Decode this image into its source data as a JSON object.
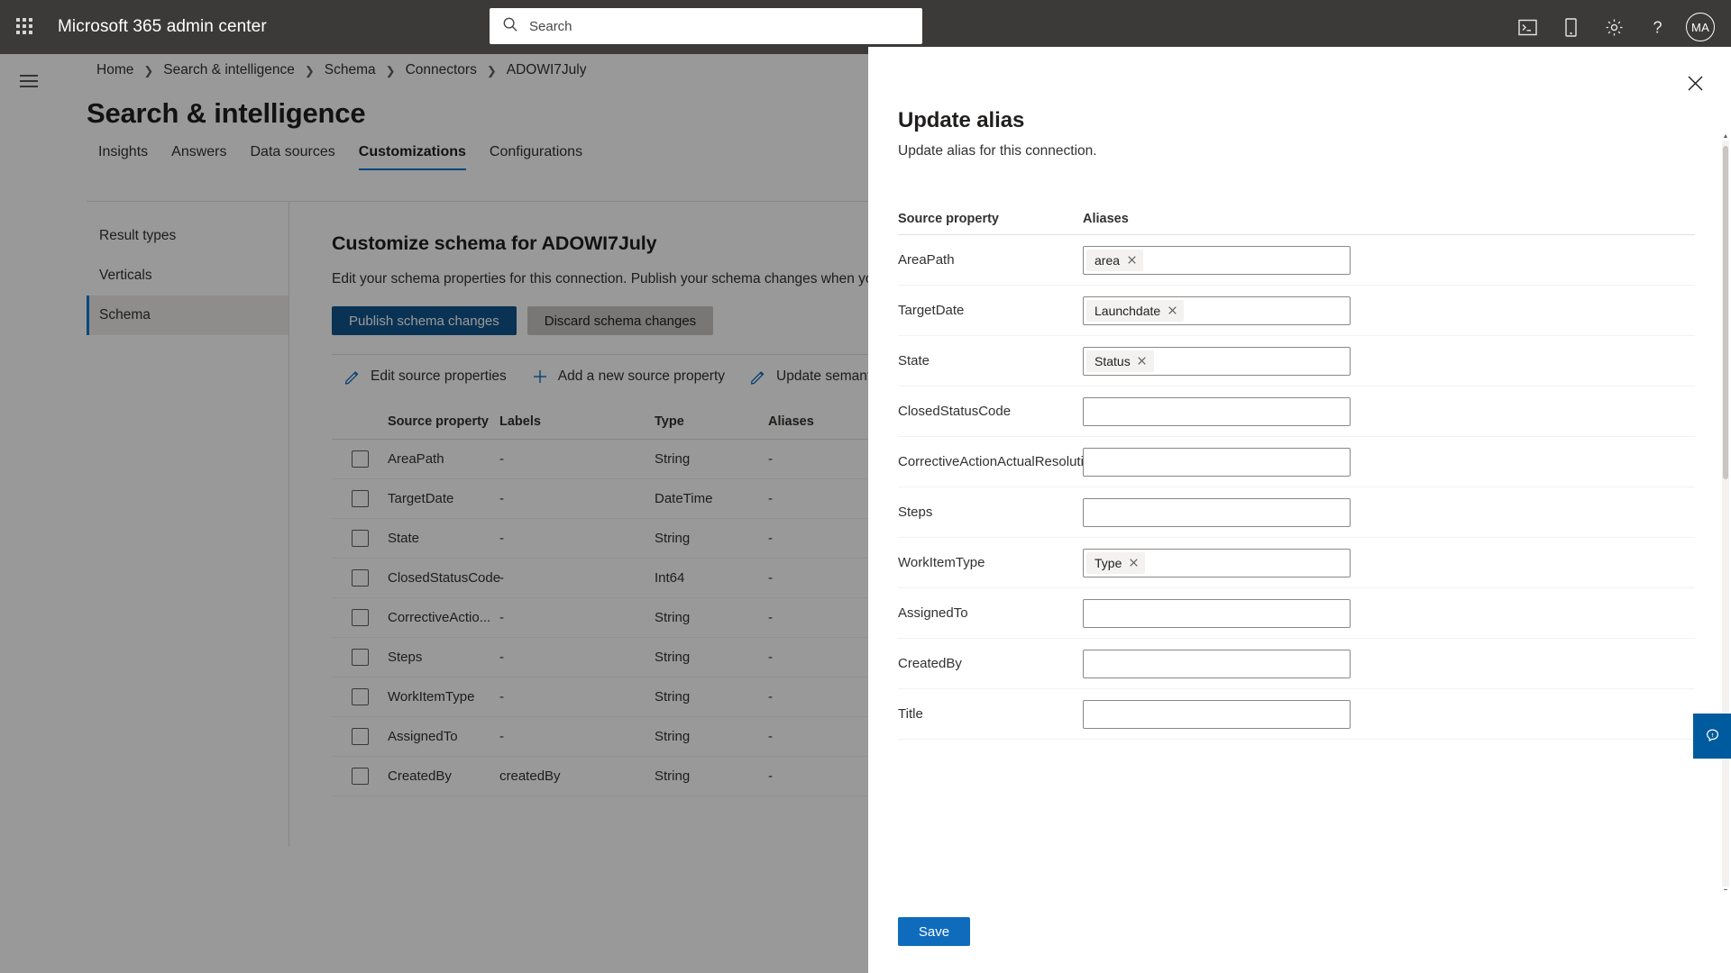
{
  "suite": {
    "waffle_label": "app-launcher",
    "title": "Microsoft 365 admin center",
    "search_placeholder": "Search",
    "icons": [
      "console-icon",
      "mobile-icon",
      "gear-icon",
      "help-icon"
    ],
    "avatar_initials": "MA",
    "background": "#3b3a39"
  },
  "breadcrumb": [
    {
      "label": "Home"
    },
    {
      "label": "Search & intelligence"
    },
    {
      "label": "Schema"
    },
    {
      "label": "Connectors"
    },
    {
      "label": "ADOWI7July"
    }
  ],
  "page": {
    "title": "Search & intelligence",
    "tabs": [
      {
        "label": "Insights",
        "active": false
      },
      {
        "label": "Answers",
        "active": false
      },
      {
        "label": "Data sources",
        "active": false
      },
      {
        "label": "Customizations",
        "active": true
      },
      {
        "label": "Configurations",
        "active": false
      }
    ],
    "accent": "#0078d4"
  },
  "leftnav": {
    "items": [
      {
        "label": "Result types",
        "selected": false
      },
      {
        "label": "Verticals",
        "selected": false
      },
      {
        "label": "Schema",
        "selected": true
      }
    ]
  },
  "main": {
    "heading": "Customize schema for ADOWI7July",
    "description": "Edit your schema properties for this connection. Publish your schema changes when you're done.",
    "publish_label": "Publish schema changes",
    "discard_label": "Discard schema changes",
    "commands": [
      {
        "label": "Edit source properties",
        "icon": "pencil-icon"
      },
      {
        "label": "Add a new source property",
        "icon": "plus-icon"
      },
      {
        "label": "Update semantic labels",
        "icon": "pencil-icon"
      }
    ],
    "table": {
      "columns": [
        "Source property",
        "Labels",
        "Type",
        "Aliases"
      ],
      "rows": [
        {
          "property": "AreaPath",
          "labels": "-",
          "type": "String",
          "aliases": "-"
        },
        {
          "property": "TargetDate",
          "labels": "-",
          "type": "DateTime",
          "aliases": "-"
        },
        {
          "property": "State",
          "labels": "-",
          "type": "String",
          "aliases": "-"
        },
        {
          "property": "ClosedStatusCode",
          "labels": "-",
          "type": "Int64",
          "aliases": "-"
        },
        {
          "property": "CorrectiveActio...",
          "labels": "-",
          "type": "String",
          "aliases": "-"
        },
        {
          "property": "Steps",
          "labels": "-",
          "type": "String",
          "aliases": "-"
        },
        {
          "property": "WorkItemType",
          "labels": "-",
          "type": "String",
          "aliases": "-"
        },
        {
          "property": "AssignedTo",
          "labels": "-",
          "type": "String",
          "aliases": "-"
        },
        {
          "property": "CreatedBy",
          "labels": "createdBy",
          "type": "String",
          "aliases": "-"
        }
      ]
    }
  },
  "panel": {
    "title": "Update alias",
    "subtitle": "Update alias for this connection.",
    "close_icon": "close-icon",
    "columns": {
      "property": "Source property",
      "aliases": "Aliases"
    },
    "rows": [
      {
        "property": "AreaPath",
        "aliases": [
          "area"
        ]
      },
      {
        "property": "TargetDate",
        "aliases": [
          "Launchdate"
        ]
      },
      {
        "property": "State",
        "aliases": [
          "Status"
        ]
      },
      {
        "property": "ClosedStatusCode",
        "aliases": []
      },
      {
        "property": "CorrectiveActionActualResolution",
        "aliases": []
      },
      {
        "property": "Steps",
        "aliases": []
      },
      {
        "property": "WorkItemType",
        "aliases": [
          "Type"
        ]
      },
      {
        "property": "AssignedTo",
        "aliases": []
      },
      {
        "property": "CreatedBy",
        "aliases": []
      },
      {
        "property": "Title",
        "aliases": []
      }
    ],
    "save_label": "Save",
    "save_color": "#0f6cbd"
  },
  "feedback": {
    "icon": "feedback-icon",
    "color": "#005a9e"
  }
}
